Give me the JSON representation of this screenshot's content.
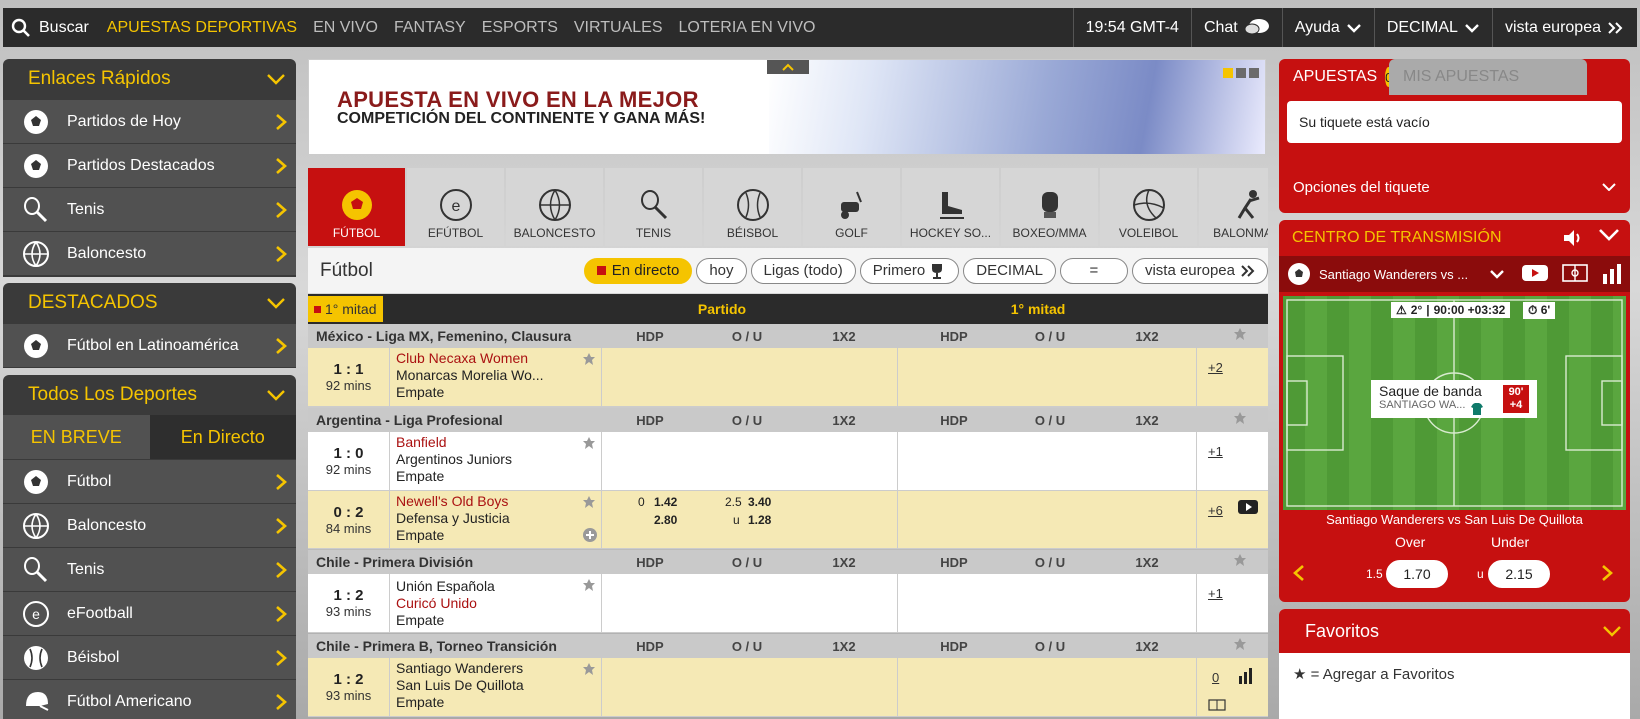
{
  "topbar": {
    "search_label": "Buscar",
    "nav": [
      "APUESTAS DEPORTIVAS",
      "EN VIVO",
      "FANTASY",
      "ESPORTS",
      "VIRTUALES",
      "LOTERIA EN VIVO"
    ],
    "clock": "19:54 GMT-4",
    "chat": "Chat",
    "help": "Ayuda",
    "odds_format": "DECIMAL",
    "view": "vista europea"
  },
  "quick_links": {
    "title": "Enlaces Rápidos",
    "items": [
      {
        "label": "Partidos de Hoy",
        "icon": "soccer-ball-icon"
      },
      {
        "label": "Partidos Destacados",
        "icon": "soccer-ball-icon"
      },
      {
        "label": "Tenis",
        "icon": "tennis-racket-icon"
      },
      {
        "label": "Baloncesto",
        "icon": "basketball-icon"
      }
    ]
  },
  "featured": {
    "title": "DESTACADOS",
    "items": [
      {
        "label": "Fútbol en Latinoamérica",
        "icon": "soccer-ball-icon"
      }
    ]
  },
  "all_sports": {
    "title": "Todos Los Deportes",
    "tabs": [
      "EN BREVE",
      "En Directo"
    ],
    "items": [
      {
        "label": "Fútbol",
        "icon": "soccer-ball-icon"
      },
      {
        "label": "Baloncesto",
        "icon": "basketball-icon"
      },
      {
        "label": "Tenis",
        "icon": "tennis-racket-icon"
      },
      {
        "label": "eFootball",
        "icon": "efootball-icon"
      },
      {
        "label": "Béisbol",
        "icon": "baseball-icon"
      },
      {
        "label": "Fútbol Americano",
        "icon": "football-helmet-icon"
      }
    ]
  },
  "banner": {
    "line1": "APUESTA EN VIVO EN LA MEJOR",
    "line2": "COMPETICIÓN DEL CONTINENTE Y GANA MÁS!"
  },
  "sports_tabs": [
    "FÚTBOL",
    "EFÚTBOL",
    "BALONCESTO",
    "TENIS",
    "BÉISBOL",
    "GOLF",
    "HOCKEY SO...",
    "BOXEO/MMA",
    "VOLEIBOL",
    "BALONMA..."
  ],
  "filter": {
    "title": "Fútbol",
    "live": "En directo",
    "today": "hoy",
    "leagues": "Ligas (todo)",
    "first": "Primero",
    "decimal": "DECIMAL",
    "equals": "=",
    "view": "vista europea"
  },
  "table_header": {
    "half": "1° mitad",
    "match": "Partido",
    "first_half": "1° mitad",
    "cols": [
      "HDP",
      "O / U",
      "1X2"
    ]
  },
  "leagues": [
    {
      "name": "México - Liga MX, Femenino, Clausura"
    },
    {
      "name": "Argentina - Liga Profesional"
    },
    {
      "name": "Chile - Primera División"
    },
    {
      "name": "Chile - Primera B, Torneo Transición"
    }
  ],
  "matches": [
    {
      "score": "1 : 1",
      "mins": "92 mins",
      "home": "Club Necaxa Women",
      "away": "Monarcas Morelia Wo...",
      "draw": "Empate",
      "more": "+2"
    },
    {
      "score": "1 : 0",
      "mins": "92 mins",
      "home": "Banfield",
      "away": "Argentinos Juniors",
      "draw": "Empate",
      "more": "+1"
    },
    {
      "score": "0 : 2",
      "mins": "84 mins",
      "home": "Newell's Old Boys",
      "away": "Defensa y Justicia",
      "draw": "Empate",
      "more": "+6",
      "hdp_line": "0",
      "hdp_home": "1.42",
      "hdp_away": "2.80",
      "ou_line": "2.5",
      "ou_over": "3.40",
      "ou_u": "u",
      "ou_under": "1.28"
    },
    {
      "score": "1 : 2",
      "mins": "93 mins",
      "home": "Unión Española",
      "away": "Curicó Unido",
      "draw": "Empate",
      "more": "+1"
    },
    {
      "score": "1 : 2",
      "mins": "93 mins",
      "home": "Santiago Wanderers",
      "away": "San Luis De Quillota",
      "draw": "Empate",
      "more": "0"
    }
  ],
  "betslip": {
    "tab_bets": "APUESTAS",
    "count": "0",
    "tab_my_bets": "MIS APUESTAS",
    "empty": "Su tiquete está vacío",
    "options": "Opciones del tiquete"
  },
  "stream": {
    "title": "CENTRO DE TRANSMISIÓN",
    "match": "Santiago Wanderers vs ...",
    "half": "2°",
    "time": "90:00 +03:32",
    "stopwatch": "6'",
    "event": "Saque de banda",
    "event_team": "SANTIAGO WA...",
    "minute": "90'",
    "added": "+4",
    "full_match": "Santiago Wanderers vs San Luis De Quillota",
    "over_label": "Over",
    "under_label": "Under",
    "line": "1.5",
    "over_odds": "1.70",
    "u": "u",
    "under_odds": "2.15"
  },
  "favorites": {
    "title": "Favoritos",
    "hint": "= Agregar a Favoritos"
  },
  "colors": {
    "accent": "#f5c400",
    "brand_red": "#c61010",
    "dark": "#2b2b2b"
  }
}
